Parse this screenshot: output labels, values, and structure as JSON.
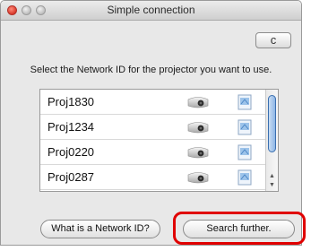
{
  "window": {
    "title": "Simple connection"
  },
  "toolbar": {
    "refresh_icon": "refresh-icon",
    "refresh_glyph": "c"
  },
  "instruction": "Select the Network ID for the projector you want to use.",
  "projectors": [
    {
      "name": "Proj1830"
    },
    {
      "name": "Proj1234"
    },
    {
      "name": "Proj0220"
    },
    {
      "name": "Proj0287"
    }
  ],
  "buttons": {
    "network_id": "What is a Network ID?",
    "search_further": "Search further."
  },
  "colors": {
    "highlight": "#e00000",
    "scroll_thumb": "#8fb6e4",
    "close_button": "#d8392b"
  }
}
